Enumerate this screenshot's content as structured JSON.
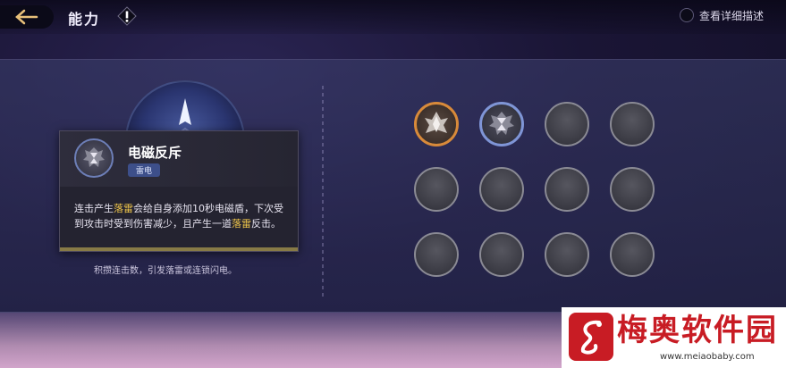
{
  "header": {
    "title": "能力",
    "info_icon": "exclamation-icon",
    "detail_toggle_label": "查看详细描述",
    "detail_toggle_on": false
  },
  "skill_panel": {
    "tagline": "积攒连击数，引发落雷或连锁闪电。"
  },
  "tooltip": {
    "name": "电磁反斥",
    "element_tag": "雷电",
    "desc_parts": {
      "p1": "连击产生",
      "h1": "落雷",
      "p2": "会给自身添加10秒电磁盾，下次受到攻击时受到伤害减少，且产生一道",
      "h2": "落雷",
      "p3": "反击。"
    },
    "icon": "hourglass-crest-icon"
  },
  "ability_slots": [
    {
      "state": "equipped",
      "icon": "crystal-crest-icon",
      "color": "#d88a3a"
    },
    {
      "state": "equipped",
      "icon": "hourglass-crest-icon",
      "color": "#7f95d6"
    },
    {
      "state": "empty"
    },
    {
      "state": "empty"
    },
    {
      "state": "empty"
    },
    {
      "state": "empty"
    },
    {
      "state": "empty"
    },
    {
      "state": "empty"
    },
    {
      "state": "empty"
    },
    {
      "state": "empty"
    },
    {
      "state": "empty"
    },
    {
      "state": "empty"
    }
  ],
  "watermark": {
    "name": "梅奥软件园",
    "url": "www.meiaobaby.com"
  },
  "colors": {
    "highlight": "#f2c84b",
    "accent_orange": "#d88a3a",
    "accent_blue": "#7f95d6"
  }
}
